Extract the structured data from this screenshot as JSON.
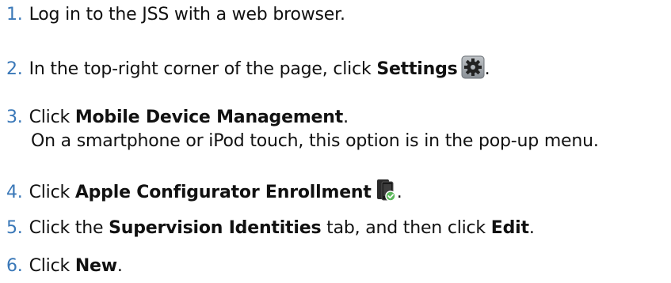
{
  "steps": [
    {
      "num": "1.",
      "text": "Log in to the JSS with a web browser."
    },
    {
      "num": "2.",
      "pre": "In the top-right corner of the page, click ",
      "bold": "Settings",
      "post": "."
    },
    {
      "num": "3.",
      "pre": "Click ",
      "bold": "Mobile Device Management",
      "post": ".",
      "note": "On a smartphone or iPod touch, this option is in the pop-up menu."
    },
    {
      "num": "4.",
      "pre": "Click ",
      "bold": "Apple Configurator Enrollment",
      "post": "."
    },
    {
      "num": "5.",
      "pre": "Click the ",
      "bold": "Supervision Identities",
      "mid": " tab, and then click ",
      "bold2": "Edit",
      "post": "."
    },
    {
      "num": "6.",
      "pre": "Click ",
      "bold": "New",
      "post": "."
    }
  ],
  "icons": {
    "settings": "gear-icon",
    "enrollment": "mobile-device-check-icon"
  },
  "colors": {
    "number": "#3a78b8",
    "text": "#111111"
  }
}
